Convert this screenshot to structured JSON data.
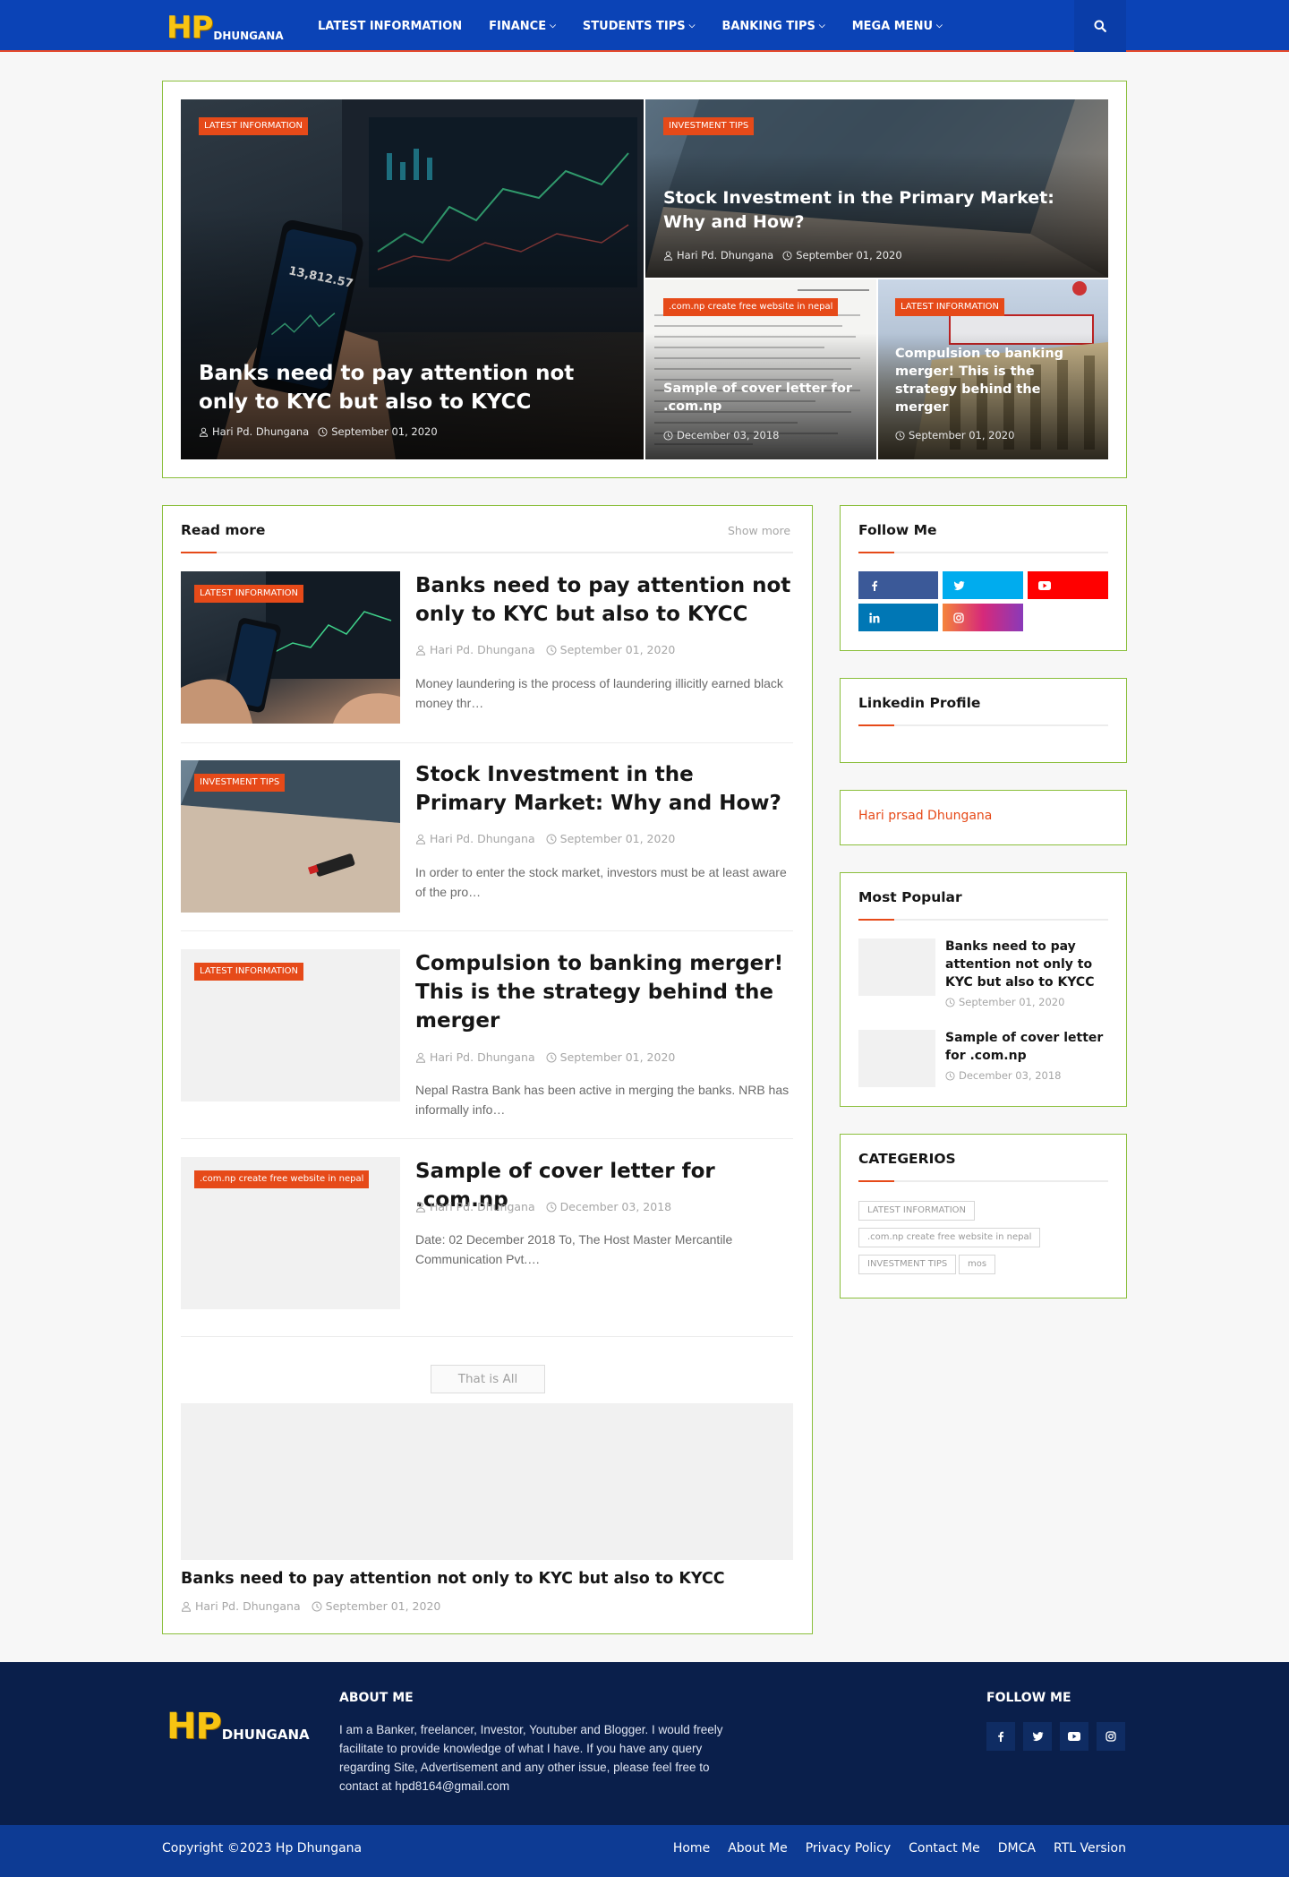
{
  "header": {
    "logo_hp": "HP",
    "logo_name": "DHUNGANA",
    "nav": [
      {
        "label": "LATEST INFORMATION",
        "dropdown": false
      },
      {
        "label": "FINANCE",
        "dropdown": true
      },
      {
        "label": "STUDENTS TIPS",
        "dropdown": true
      },
      {
        "label": "BANKING TIPS",
        "dropdown": true
      },
      {
        "label": "MEGA MENU",
        "dropdown": true
      }
    ],
    "search_icon": "search-icon"
  },
  "featured": [
    {
      "tag": "LATEST INFORMATION",
      "title": "Banks need to pay attention not only to KYC but also to KYCC",
      "author": "Hari Pd. Dhungana",
      "date": "September 01, 2020"
    },
    {
      "tag": "INVESTMENT TIPS",
      "title": "Stock Investment in the Primary Market: Why and How?",
      "author": "Hari Pd. Dhungana",
      "date": "September 01, 2020"
    },
    {
      "tag": ".com.np create free website in nepal",
      "title": "Sample of cover letter for .com.np",
      "date": "December 03, 2018"
    },
    {
      "tag": "LATEST INFORMATION",
      "title": "Compulsion to banking merger! This is the strategy behind the merger",
      "date": "September 01, 2020"
    }
  ],
  "read_more": {
    "heading": "Read more",
    "show_more": "Show more",
    "posts": [
      {
        "tag": "LATEST INFORMATION",
        "title": "Banks need to pay attention not only to KYC but also to KYCC",
        "author": "Hari Pd. Dhungana",
        "date": "September 01, 2020",
        "excerpt": "Money laundering is the process of laundering illicitly earned black money thr…"
      },
      {
        "tag": "INVESTMENT TIPS",
        "title": "Stock Investment in the Primary Market: Why and How?",
        "author": "Hari Pd. Dhungana",
        "date": "September 01, 2020",
        "excerpt": "In order to enter the stock market, investors must be at least aware of the pro…"
      },
      {
        "tag": "LATEST INFORMATION",
        "title": "Compulsion to banking merger! This is the strategy behind the merger",
        "author": "Hari Pd. Dhungana",
        "date": "September 01, 2020",
        "excerpt": "Nepal Rastra Bank has been active in merging the banks. NRB has informally info…"
      },
      {
        "tag": ".com.np create free website in nepal",
        "title": "Sample of cover letter for .com.np",
        "author": "Hari Pd. Dhungana",
        "date": "December 03, 2018",
        "excerpt": "Date: 02 December 2018 To, The Host Master Mercantile Communication Pvt.…"
      }
    ],
    "end_label": "That is All",
    "bottom_post": {
      "title": "Banks need to pay attention not only to KYC but also to KYCC",
      "author": "Hari Pd. Dhungana",
      "date": "September 01, 2020"
    }
  },
  "sidebar": {
    "follow_heading": "Follow Me",
    "social": [
      {
        "icon": "facebook-icon",
        "color": "#3b5998"
      },
      {
        "icon": "twitter-icon",
        "color": "#00acee"
      },
      {
        "icon": "youtube-icon",
        "color": "#ff0000"
      },
      {
        "icon": "linkedin-icon",
        "color": "#0077b5"
      },
      {
        "icon": "instagram-icon",
        "color": "#c13584"
      }
    ],
    "linkedin_heading": "Linkedin Profile",
    "profile_link": "Hari prsad Dhungana",
    "popular_heading": "Most Popular",
    "popular": [
      {
        "title": "Banks need to pay attention not only to KYC but also to KYCC",
        "date": "September 01, 2020"
      },
      {
        "title": "Sample of cover letter for .com.np",
        "date": "December 03, 2018"
      }
    ],
    "categories_heading": "CATEGERIOS",
    "categories": [
      "LATEST INFORMATION",
      ".com.np create free website in nepal",
      "INVESTMENT TIPS",
      "mos"
    ]
  },
  "footer": {
    "logo_hp": "HP",
    "logo_name": "DHUNGANA",
    "about_heading": "ABOUT ME",
    "about_text": "I am a Banker, freelancer, Investor, Youtuber and Blogger. I would freely facilitate to provide knowledge of what I have. If you have any query regarding Site, Advertisement and any other issue, please feel free to contact at hpd8164@gmail.com",
    "follow_heading": "FOLLOW ME",
    "copyright": "Copyright ©2023 Hp Dhungana",
    "links": [
      "Home",
      "About Me",
      "Privacy Policy",
      "Contact Me",
      "DMCA",
      "RTL Version"
    ]
  },
  "colors": {
    "header_bg": "#0b43b6",
    "accent": "#e64a19",
    "box_border": "#8bbf3c",
    "footer_bg": "#0a1f4b",
    "footer_bar": "#0d3b94",
    "logo_yellow": "#f8c412"
  }
}
